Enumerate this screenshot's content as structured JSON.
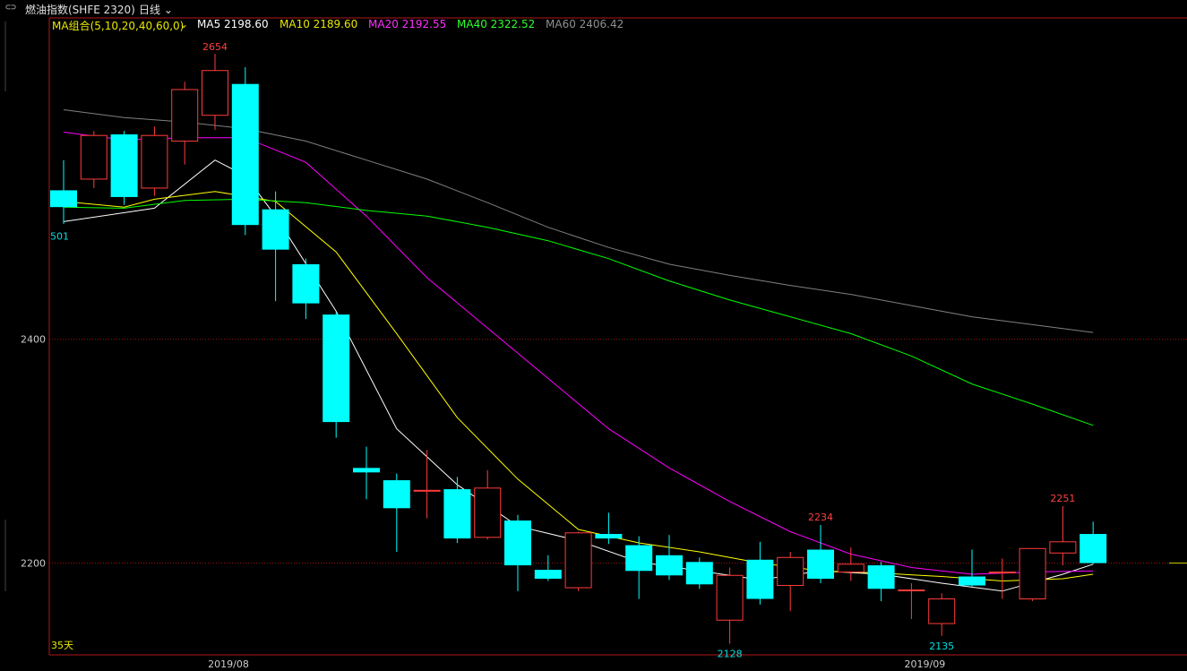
{
  "header": {
    "symbol_icon": "link-icon",
    "title": "燃油指数(SHFE 2320)",
    "period": "日线"
  },
  "ma_legend": {
    "group": "MA组合(5,10,20,40,60,0)",
    "items": [
      {
        "label": "MA5 2198.60",
        "color": "#ffffff"
      },
      {
        "label": "MA10 2189.60",
        "color": "#ffff00"
      },
      {
        "label": "MA20 2192.55",
        "color": "#ff00ff"
      },
      {
        "label": "MA40 2322.52",
        "color": "#00ff00"
      },
      {
        "label": "MA60 2406.42",
        "color": "#808080"
      }
    ]
  },
  "colors": {
    "up": "#ff3b3b",
    "down": "#00ffff",
    "grid": "#a01010",
    "axis_label": "#cccccc",
    "frame": "#b01818"
  },
  "chart_data": {
    "type": "candlestick",
    "y_ticks": [
      2400,
      2200
    ],
    "x_ticks": [
      {
        "index": 5,
        "label": "2019/08"
      },
      {
        "index": 28,
        "label": "2019/09"
      }
    ],
    "annotations": [
      {
        "index": 5,
        "value": 2654,
        "label": "2654",
        "color": "#ff4040",
        "pos": "above"
      },
      {
        "index": 0,
        "value": 2501,
        "label": "501",
        "color": "#00e0e0",
        "pos": "below"
      },
      {
        "index": 25,
        "value": 2234,
        "label": "2234",
        "color": "#ff4040",
        "pos": "above"
      },
      {
        "index": 22,
        "value": 2128,
        "label": "2128",
        "color": "#00e0e0",
        "pos": "below"
      },
      {
        "index": 29,
        "value": 2135,
        "label": "2135",
        "color": "#00e0e0",
        "pos": "below"
      },
      {
        "index": 33,
        "value": 2251,
        "label": "2251",
        "color": "#ff4040",
        "pos": "above"
      }
    ],
    "bottom_label": "35天",
    "ylim": [
      2118,
      2687
    ],
    "candles": [
      {
        "o": 2533,
        "h": 2560,
        "l": 2503,
        "c": 2518
      },
      {
        "o": 2543,
        "h": 2586,
        "l": 2535,
        "c": 2582
      },
      {
        "o": 2583,
        "h": 2586,
        "l": 2520,
        "c": 2527
      },
      {
        "o": 2535,
        "h": 2590,
        "l": 2528,
        "c": 2582
      },
      {
        "o": 2577,
        "h": 2630,
        "l": 2556,
        "c": 2623
      },
      {
        "o": 2600,
        "h": 2655,
        "l": 2587,
        "c": 2640
      },
      {
        "o": 2628,
        "h": 2643,
        "l": 2493,
        "c": 2502
      },
      {
        "o": 2516,
        "h": 2532,
        "l": 2434,
        "c": 2480
      },
      {
        "o": 2467,
        "h": 2472,
        "l": 2418,
        "c": 2432
      },
      {
        "o": 2422,
        "h": 2424,
        "l": 2312,
        "c": 2326
      },
      {
        "o": 2285,
        "h": 2304,
        "l": 2257,
        "c": 2281
      },
      {
        "o": 2274,
        "h": 2280,
        "l": 2210,
        "c": 2249
      },
      {
        "o": 2265,
        "h": 2301,
        "l": 2240,
        "c": 2265
      },
      {
        "o": 2266,
        "h": 2277,
        "l": 2218,
        "c": 2222
      },
      {
        "o": 2223,
        "h": 2283,
        "l": 2221,
        "c": 2267
      },
      {
        "o": 2238,
        "h": 2243,
        "l": 2175,
        "c": 2198
      },
      {
        "o": 2194,
        "h": 2207,
        "l": 2184,
        "c": 2186
      },
      {
        "o": 2178,
        "h": 2228,
        "l": 2175,
        "c": 2227
      },
      {
        "o": 2226,
        "h": 2245,
        "l": 2217,
        "c": 2222
      },
      {
        "o": 2216,
        "h": 2224,
        "l": 2168,
        "c": 2193
      },
      {
        "o": 2207,
        "h": 2225,
        "l": 2185,
        "c": 2189
      },
      {
        "o": 2201,
        "h": 2205,
        "l": 2177,
        "c": 2181
      },
      {
        "o": 2149,
        "h": 2196,
        "l": 2128,
        "c": 2189
      },
      {
        "o": 2203,
        "h": 2219,
        "l": 2163,
        "c": 2168
      },
      {
        "o": 2180,
        "h": 2210,
        "l": 2157,
        "c": 2205
      },
      {
        "o": 2212,
        "h": 2234,
        "l": 2182,
        "c": 2186
      },
      {
        "o": 2192,
        "h": 2214,
        "l": 2184,
        "c": 2199
      },
      {
        "o": 2198,
        "h": 2201,
        "l": 2166,
        "c": 2177
      },
      {
        "o": 2176,
        "h": 2182,
        "l": 2150,
        "c": 2176
      },
      {
        "o": 2146,
        "h": 2173,
        "l": 2135,
        "c": 2168
      },
      {
        "o": 2188,
        "h": 2212,
        "l": 2179,
        "c": 2180
      },
      {
        "o": 2192,
        "h": 2204,
        "l": 2168,
        "c": 2192
      },
      {
        "o": 2168,
        "h": 2213,
        "l": 2166,
        "c": 2213
      },
      {
        "o": 2209,
        "h": 2251,
        "l": 2198,
        "c": 2219
      },
      {
        "o": 2226,
        "h": 2237,
        "l": 2199,
        "c": 2200
      }
    ],
    "ma_series": [
      {
        "name": "MA5",
        "color": "#ffffff",
        "points": [
          [
            0,
            2505
          ],
          [
            3,
            2517
          ],
          [
            5,
            2560
          ],
          [
            6,
            2546
          ],
          [
            7,
            2510
          ],
          [
            9,
            2425
          ],
          [
            11,
            2320
          ],
          [
            13,
            2270
          ],
          [
            15,
            2233
          ],
          [
            17,
            2220
          ],
          [
            19,
            2201
          ],
          [
            21,
            2193
          ],
          [
            23,
            2185
          ],
          [
            25,
            2193
          ],
          [
            27,
            2190
          ],
          [
            29,
            2182
          ],
          [
            31,
            2175
          ],
          [
            33,
            2190
          ],
          [
            34,
            2199
          ]
        ]
      },
      {
        "name": "MA10",
        "color": "#ffff00",
        "points": [
          [
            0,
            2523
          ],
          [
            2,
            2518
          ],
          [
            3,
            2525
          ],
          [
            5,
            2532
          ],
          [
            7,
            2523
          ],
          [
            9,
            2478
          ],
          [
            11,
            2405
          ],
          [
            13,
            2330
          ],
          [
            15,
            2275
          ],
          [
            17,
            2230
          ],
          [
            19,
            2218
          ],
          [
            21,
            2210
          ],
          [
            23,
            2200
          ],
          [
            25,
            2193
          ],
          [
            27,
            2191
          ],
          [
            29,
            2188
          ],
          [
            31,
            2184
          ],
          [
            33,
            2186
          ],
          [
            34,
            2190
          ]
        ]
      },
      {
        "name": "MA20",
        "color": "#ff00ff",
        "points": [
          [
            0,
            2585
          ],
          [
            2,
            2578
          ],
          [
            4,
            2580
          ],
          [
            6,
            2580
          ],
          [
            8,
            2558
          ],
          [
            10,
            2510
          ],
          [
            12,
            2455
          ],
          [
            14,
            2410
          ],
          [
            16,
            2365
          ],
          [
            18,
            2320
          ],
          [
            20,
            2285
          ],
          [
            22,
            2255
          ],
          [
            24,
            2228
          ],
          [
            26,
            2208
          ],
          [
            28,
            2196
          ],
          [
            30,
            2190
          ],
          [
            32,
            2192
          ],
          [
            34,
            2193
          ]
        ]
      },
      {
        "name": "MA40",
        "color": "#00ff00",
        "points": [
          [
            0,
            2518
          ],
          [
            2,
            2517
          ],
          [
            4,
            2524
          ],
          [
            6,
            2525
          ],
          [
            8,
            2522
          ],
          [
            10,
            2515
          ],
          [
            12,
            2510
          ],
          [
            14,
            2500
          ],
          [
            16,
            2488
          ],
          [
            18,
            2472
          ],
          [
            20,
            2452
          ],
          [
            22,
            2435
          ],
          [
            24,
            2420
          ],
          [
            26,
            2405
          ],
          [
            28,
            2385
          ],
          [
            30,
            2360
          ],
          [
            32,
            2342
          ],
          [
            34,
            2323
          ]
        ]
      },
      {
        "name": "MA60",
        "color": "#808080",
        "points": [
          [
            0,
            2605
          ],
          [
            2,
            2598
          ],
          [
            4,
            2594
          ],
          [
            6,
            2588
          ],
          [
            8,
            2577
          ],
          [
            10,
            2560
          ],
          [
            12,
            2543
          ],
          [
            14,
            2522
          ],
          [
            16,
            2500
          ],
          [
            18,
            2482
          ],
          [
            20,
            2467
          ],
          [
            22,
            2457
          ],
          [
            24,
            2448
          ],
          [
            26,
            2440
          ],
          [
            28,
            2430
          ],
          [
            30,
            2420
          ],
          [
            32,
            2413
          ],
          [
            34,
            2406
          ]
        ]
      }
    ]
  }
}
